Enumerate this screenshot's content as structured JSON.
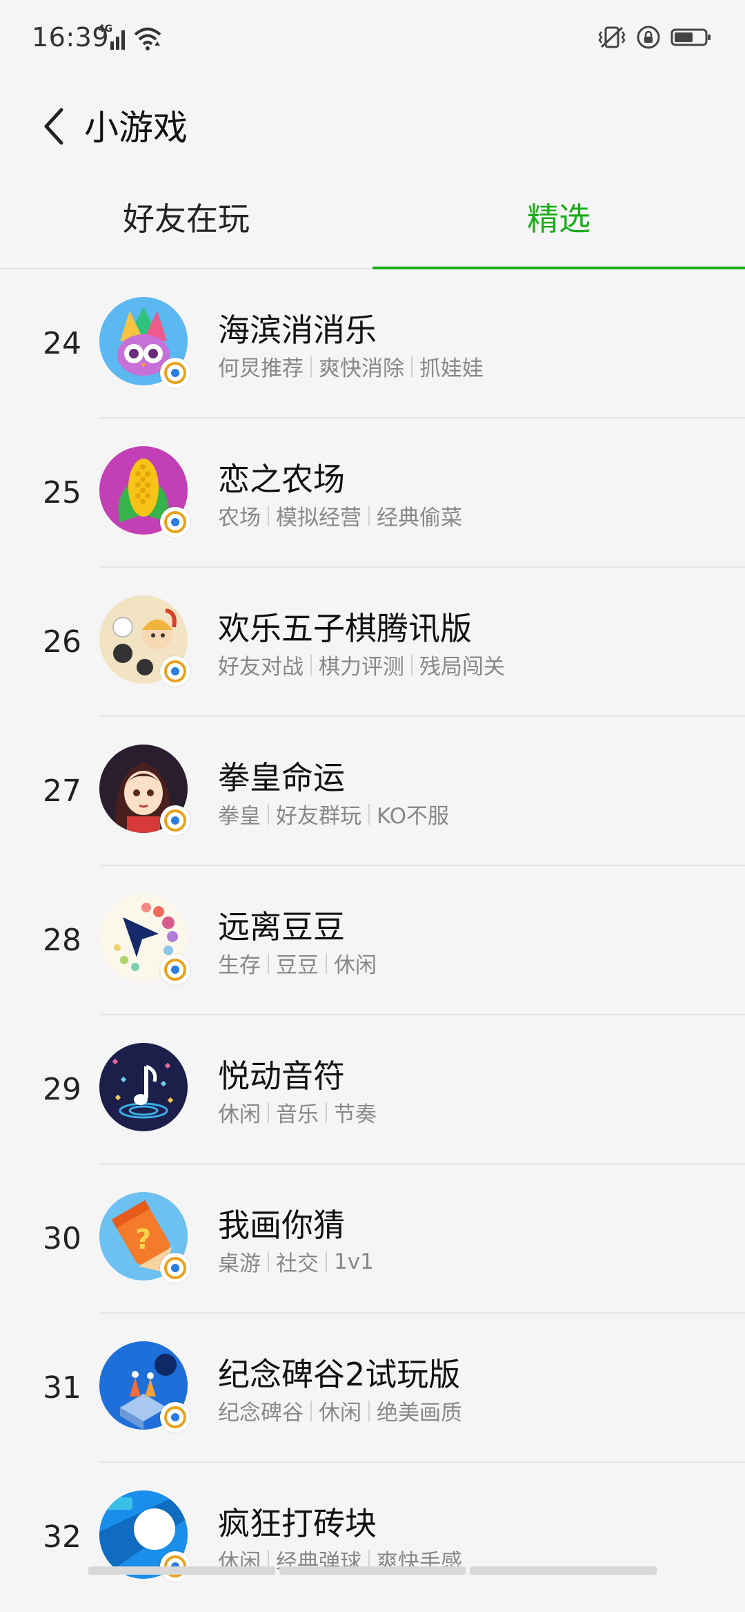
{
  "status_bar": {
    "time": "16:39",
    "network": "4G",
    "icons": [
      "signal-icon",
      "wifi-icon",
      "vibrate-icon",
      "rotation-lock-icon",
      "battery-icon"
    ]
  },
  "header": {
    "title": "小游戏"
  },
  "tabs": [
    {
      "label": "好友在玩",
      "active": false
    },
    {
      "label": "精选",
      "active": true
    }
  ],
  "colors": {
    "accent": "#1aad19",
    "background": "#f5f5f5"
  },
  "games": [
    {
      "rank": "24",
      "name": "海滨消消乐",
      "tags": [
        "何炅推荐",
        "爽快消除",
        "抓娃娃"
      ],
      "icon": "owl-feather-icon"
    },
    {
      "rank": "25",
      "name": "恋之农场",
      "tags": [
        "农场",
        "模拟经营",
        "经典偷菜"
      ],
      "icon": "corn-icon"
    },
    {
      "rank": "26",
      "name": "欢乐五子棋腾讯版",
      "tags": [
        "好友对战",
        "棋力评测",
        "残局闯关"
      ],
      "icon": "gomoku-warrior-icon"
    },
    {
      "rank": "27",
      "name": "拳皇命运",
      "tags": [
        "拳皇",
        "好友群玩",
        "KO不服"
      ],
      "icon": "fighter-girl-icon"
    },
    {
      "rank": "28",
      "name": "远离豆豆",
      "tags": [
        "生存",
        "豆豆",
        "休闲"
      ],
      "icon": "arrow-dots-icon"
    },
    {
      "rank": "29",
      "name": "悦动音符",
      "tags": [
        "休闲",
        "音乐",
        "节奏"
      ],
      "icon": "music-note-icon"
    },
    {
      "rank": "30",
      "name": "我画你猜",
      "tags": [
        "桌游",
        "社交",
        "1v1"
      ],
      "icon": "pencil-question-icon"
    },
    {
      "rank": "31",
      "name": "纪念碑谷2试玩版",
      "tags": [
        "纪念碑谷",
        "休闲",
        "绝美画质"
      ],
      "icon": "monument-valley-icon"
    },
    {
      "rank": "32",
      "name": "疯狂打砖块",
      "tags": [
        "休闲",
        "经典弹球",
        "爽快手感"
      ],
      "icon": "brick-ball-icon"
    }
  ]
}
